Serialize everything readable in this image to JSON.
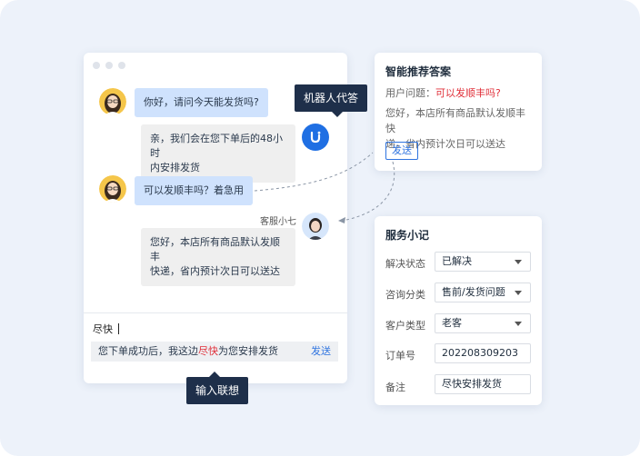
{
  "chat": {
    "messages": [
      {
        "sender": "customer",
        "text": "你好，请问今天能发货吗?"
      },
      {
        "sender": "bot",
        "lines": [
          "亲，我们会在您下单后的48小时",
          "内安排发货"
        ]
      },
      {
        "sender": "customer",
        "text": "可以发顺丰吗？着急用"
      },
      {
        "sender": "agent",
        "name": "客服小七",
        "lines": [
          "您好，本店所有商品默认发顺丰",
          "快递，省内预计次日可以送达"
        ]
      }
    ],
    "input_text": "尽快",
    "suggestion": {
      "prefix": "您下单成功后，我这边",
      "highlight": "尽快",
      "suffix": "为您安排发货",
      "send": "发送"
    }
  },
  "tooltips": {
    "bot_reply": "机器人代答",
    "input_assoc": "输入联想"
  },
  "answer_card": {
    "title": "智能推荐答案",
    "question_label": "用户问题：",
    "question": "可以发顺丰吗?",
    "answer_lines": [
      "您好，本店所有商品默认发顺丰快",
      "递，省内预计次日可以送达"
    ],
    "send": "发送"
  },
  "notes_card": {
    "title": "服务小记",
    "fields": [
      {
        "label": "解决状态",
        "value": "已解决",
        "dropdown": true
      },
      {
        "label": "咨询分类",
        "value": "售前/发货问题",
        "dropdown": true
      },
      {
        "label": "客户类型",
        "value": "老客",
        "dropdown": true
      },
      {
        "label": "订单号",
        "value": "202208309203",
        "dropdown": false
      },
      {
        "label": "备注",
        "value": "尽快安排发货",
        "dropdown": false
      }
    ]
  },
  "colors": {
    "accent": "#2f74e0",
    "highlight": "#e0303a",
    "user_bubble": "#cfe2fd",
    "tooltip": "#1e2f4a"
  }
}
